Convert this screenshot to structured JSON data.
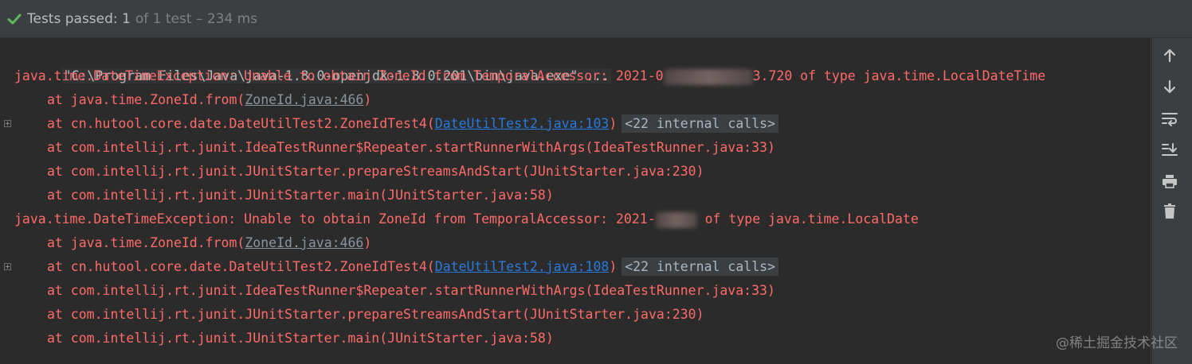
{
  "status": {
    "passed_label": "Tests passed: 1",
    "rest_label": "of 1 test – 234 ms",
    "icon": "check-icon",
    "accent": "#5fb760"
  },
  "console": {
    "command": "\"C:\\Program Files\\Java\\java-1.8.0-openjdk-1.8.0.201\\bin\\java.exe\" ...",
    "exception1": {
      "prefix": "java.time.DateTimeException: Unable to obtain ZoneId from TemporalAccessor: 2021-0",
      "suffix": "3.720 of type java.time.LocalDateTime"
    },
    "trace1": [
      {
        "prefix": "at java.time.ZoneId.from(",
        "link": "ZoneId.java:466",
        "suffix": ")"
      },
      {
        "prefix": "at cn.hutool.core.date.DateUtilTest2.ZoneIdTest4(",
        "link": "DateUtilTest2.java:103",
        "suffix": ")",
        "internal": "<22 internal calls>"
      },
      {
        "text": "at com.intellij.rt.junit.IdeaTestRunner$Repeater.startRunnerWithArgs(IdeaTestRunner.java:33)"
      },
      {
        "text": "at com.intellij.rt.junit.JUnitStarter.prepareStreamsAndStart(JUnitStarter.java:230)"
      },
      {
        "text": "at com.intellij.rt.junit.JUnitStarter.main(JUnitStarter.java:58)"
      }
    ],
    "exception2": {
      "prefix": "java.time.DateTimeException: Unable to obtain ZoneId from TemporalAccessor: 2021-",
      "suffix": " of type java.time.LocalDate"
    },
    "trace2": [
      {
        "prefix": "at java.time.ZoneId.from(",
        "link": "ZoneId.java:466",
        "suffix": ")"
      },
      {
        "prefix": "at cn.hutool.core.date.DateUtilTest2.ZoneIdTest4(",
        "link": "DateUtilTest2.java:108",
        "suffix": ")",
        "internal": "<22 internal calls>"
      },
      {
        "text": "at com.intellij.rt.junit.IdeaTestRunner$Repeater.startRunnerWithArgs(IdeaTestRunner.java:33)"
      },
      {
        "text": "at com.intellij.rt.junit.JUnitStarter.prepareStreamsAndStart(JUnitStarter.java:230)"
      },
      {
        "text": "at com.intellij.rt.junit.JUnitStarter.main(JUnitStarter.java:58)"
      }
    ],
    "colors": {
      "error": "#ff6b68",
      "link": "#287bde",
      "background": "#2b2b2b"
    }
  },
  "toolbar": {
    "icons": [
      "arrow-up-icon",
      "arrow-down-icon",
      "soft-wrap-icon",
      "scroll-to-end-icon",
      "print-icon",
      "trash-icon"
    ]
  },
  "watermark": "@稀土掘金技术社区"
}
